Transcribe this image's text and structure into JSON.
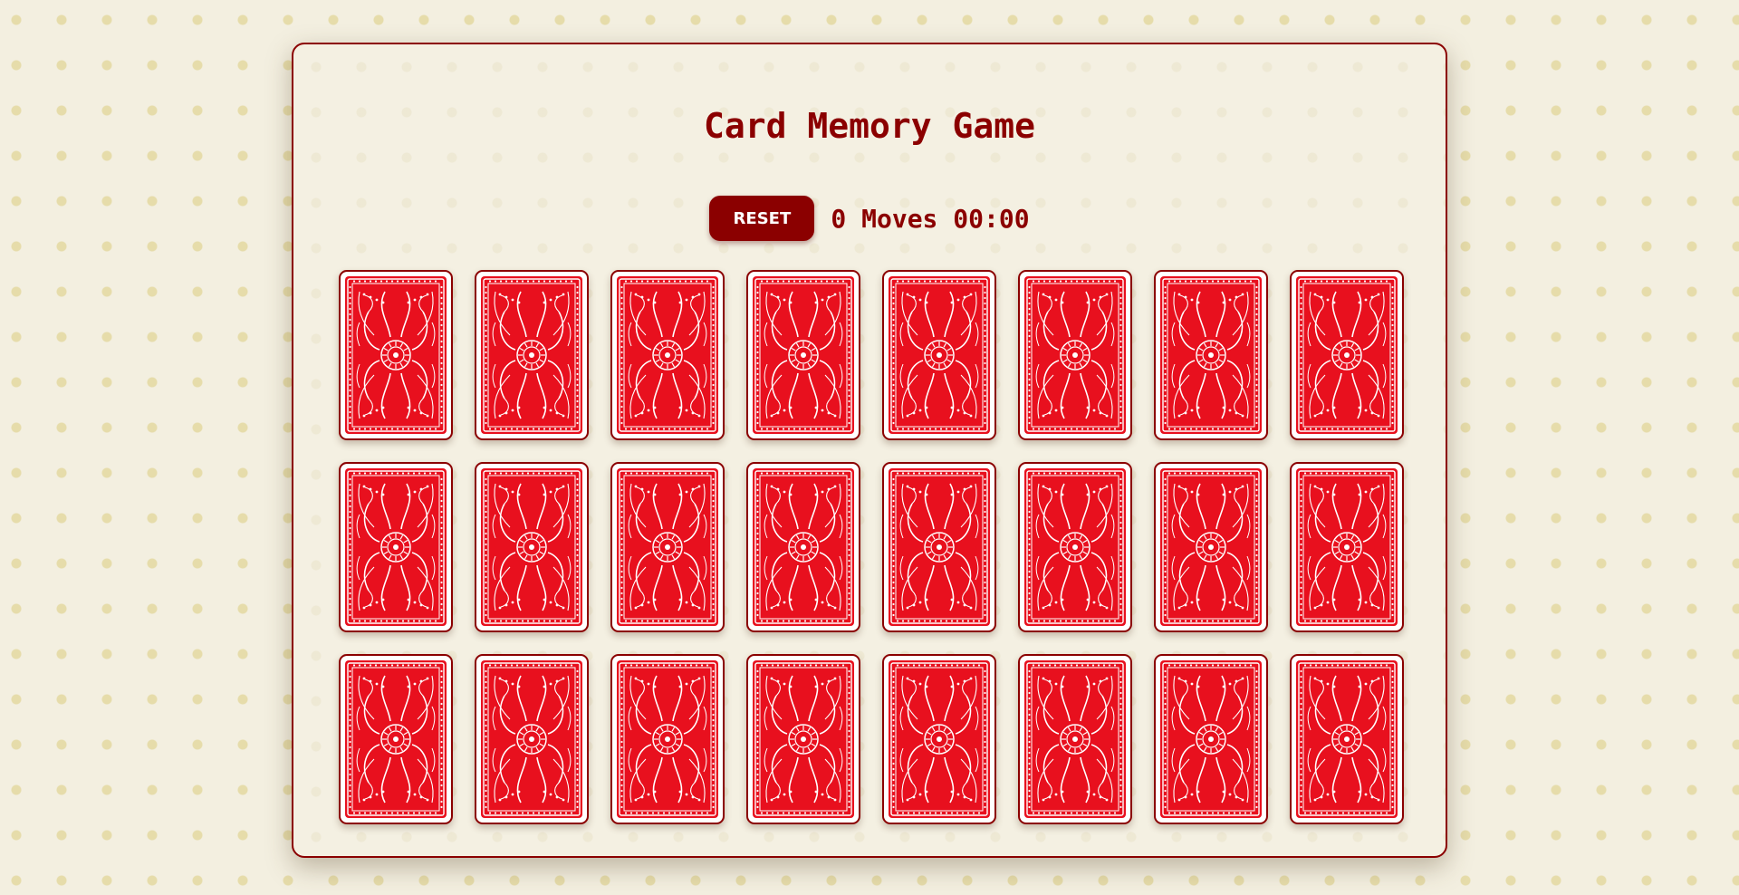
{
  "game": {
    "title": "Card Memory Game",
    "reset_label": "RESET",
    "moves": "0",
    "moves_label": "Moves",
    "timer": "00:00"
  },
  "cards": {
    "rows": 3,
    "columns": 8,
    "count": 24,
    "state": "face-down",
    "back_color": "#e8101e",
    "border_color": "#8b0000"
  },
  "colors": {
    "accent": "#8b0000",
    "background": "#f3efe0",
    "dots": "#e6dcaa"
  }
}
